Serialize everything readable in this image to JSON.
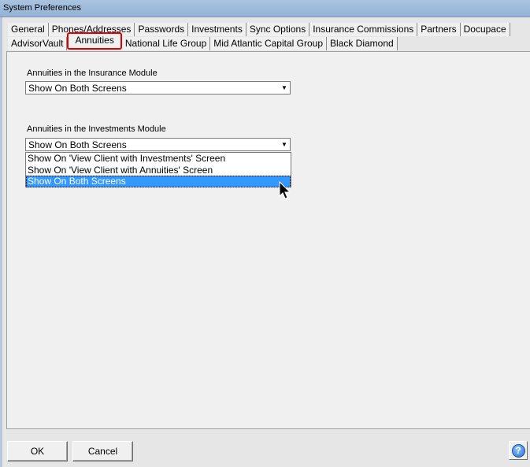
{
  "window": {
    "title": "System Preferences"
  },
  "tabs": {
    "row1": [
      "General",
      "Phones/Addresses",
      "Passwords",
      "Investments",
      "Sync Options",
      "Insurance Commissions",
      "Partners",
      "Docupace"
    ],
    "row2": [
      "AdvisorVault",
      "Annuities",
      "National Life Group",
      "Mid Atlantic Capital Group",
      "Black Diamond"
    ],
    "active": "Annuities"
  },
  "insurance_module": {
    "label": "Annuities in the Insurance Module",
    "value": "Show On Both Screens"
  },
  "investments_module": {
    "label": "Annuities in the Investments Module",
    "value": "Show On Both Screens",
    "options": [
      "Show On 'View Client with Investments' Screen",
      "Show On 'View Client with Annuities' Screen",
      "Show On Both Screens"
    ],
    "selected_index": 2
  },
  "buttons": {
    "ok": "OK",
    "cancel": "Cancel",
    "help_icon": "?"
  }
}
